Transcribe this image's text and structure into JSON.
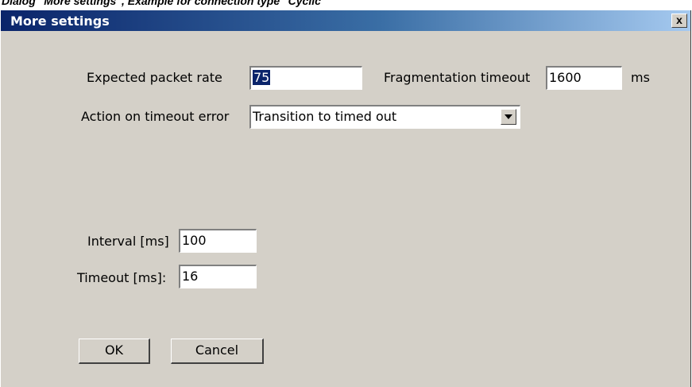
{
  "caption": "Dialog \"More settings\", Example for connection type \"Cyclic\"",
  "window": {
    "title": "More settings",
    "close_glyph": "x"
  },
  "packet_rate": {
    "label": "Expected packet rate",
    "value": "75"
  },
  "fragmentation": {
    "label": "Fragmentation timeout",
    "value": "1600",
    "unit": "ms"
  },
  "timeout_action": {
    "label": "Action on timeout error",
    "selected": "Transition to timed out"
  },
  "interval": {
    "label": "Interval [ms]",
    "value": "100"
  },
  "timeout": {
    "label": "Timeout [ms]:",
    "value": "16"
  },
  "buttons": {
    "ok": "OK",
    "cancel": "Cancel"
  },
  "colors": {
    "dialog_bg": "#d4d0c8",
    "titlebar_start": "#0a246a",
    "titlebar_end": "#a6caf0",
    "selection": "#0a246a"
  },
  "icons": {
    "close": "close-icon",
    "dropdown": "chevron-down-icon"
  }
}
